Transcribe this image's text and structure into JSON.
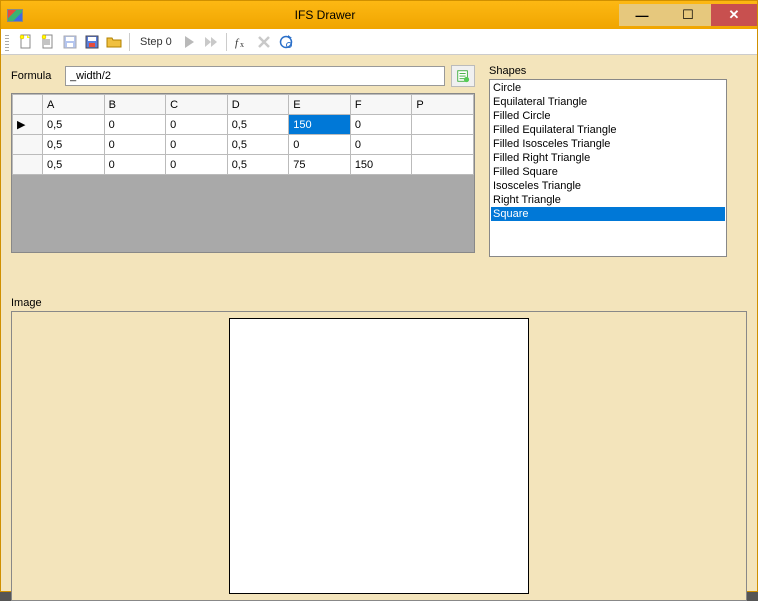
{
  "window": {
    "title": "IFS Drawer"
  },
  "toolbar": {
    "step_label": "Step 0",
    "icons": {
      "new": "new-doc-icon",
      "open": "open-doc-icon",
      "save": "save-icon",
      "saveimg": "save-image-icon",
      "folder": "folder-icon",
      "play": "play-icon",
      "ff": "fast-forward-icon",
      "fx": "fx-icon",
      "delete": "delete-icon",
      "refresh": "refresh-icon"
    }
  },
  "formula": {
    "label": "Formula",
    "value": "_width/2"
  },
  "grid": {
    "columns": [
      "A",
      "B",
      "C",
      "D",
      "E",
      "F",
      "P"
    ],
    "rows": [
      {
        "indicator": "▶",
        "cells": [
          "0,5",
          "0",
          "0",
          "0,5",
          "150",
          "0",
          ""
        ],
        "selected_col": 4
      },
      {
        "indicator": "",
        "cells": [
          "0,5",
          "0",
          "0",
          "0,5",
          "0",
          "0",
          ""
        ]
      },
      {
        "indicator": "",
        "cells": [
          "0,5",
          "0",
          "0",
          "0,5",
          "75",
          "150",
          ""
        ]
      }
    ]
  },
  "shapes": {
    "label": "Shapes",
    "items": [
      "Circle",
      "Equilateral Triangle",
      "Filled Circle",
      "Filled Equilateral Triangle",
      "Filled Isosceles Triangle",
      "Filled Right Triangle",
      "Filled Square",
      "Isosceles Triangle",
      "Right Triangle",
      "Square"
    ],
    "selected_index": 9
  },
  "image": {
    "label": "Image"
  }
}
